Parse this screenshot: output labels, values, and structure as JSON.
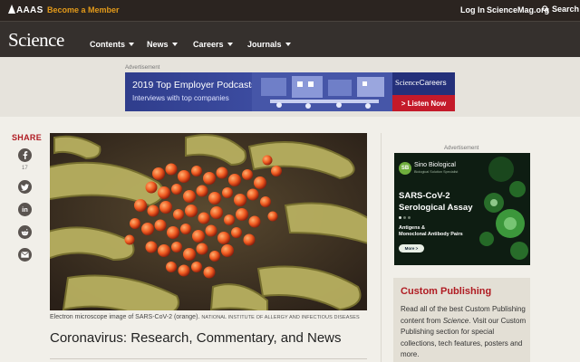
{
  "topbar": {
    "aaas": "AAAS",
    "become_member": "Become a Member",
    "login": "Log In",
    "sciencemag": "ScienceMag.org",
    "search": "Search"
  },
  "nav": {
    "logo": "Science",
    "items": [
      "Contents",
      "News",
      "Careers",
      "Journals"
    ]
  },
  "top_ad": {
    "label": "Advertisement",
    "line1": "2019 Top Employer Podcasts",
    "line2": "Interviews with top companies",
    "brand": "Science",
    "brand_suffix": "Careers",
    "cta": "> Listen Now"
  },
  "share": {
    "label": "SHARE",
    "facebook_count": "17",
    "buttons": [
      "facebook-icon",
      "twitter-icon",
      "linkedin-icon",
      "reddit-icon",
      "email-icon"
    ]
  },
  "article": {
    "caption": "Electron microscope image of SARS-CoV-2 (orange).",
    "credit": "NATIONAL INSTITUTE OF ALLERGY AND INFECTIOUS DISEASES",
    "headline": "Coronavirus: Research, Commentary, and News"
  },
  "side_ad": {
    "label": "Advertisement",
    "logo_initials": "SB",
    "brand": "Sino Biological",
    "brand_sub": "Biological Solution Specialist",
    "title_line1": "SARS-CoV-2",
    "title_line2": "Serological Assay",
    "line1": "Antigens &",
    "line2": "Monoclonal Antibody Pairs",
    "more": "More >"
  },
  "custom_publishing": {
    "title": "Custom Publishing",
    "body_pre": "Read all of the best Custom Publishing content from ",
    "body_em": "Science",
    "body_post": ". Visit our Custom Publishing section for special collections, tech features, posters and more."
  },
  "colors": {
    "accent_red": "#b01b22",
    "accent_orange": "#e39a1a",
    "header_bg": "#2b2420"
  }
}
